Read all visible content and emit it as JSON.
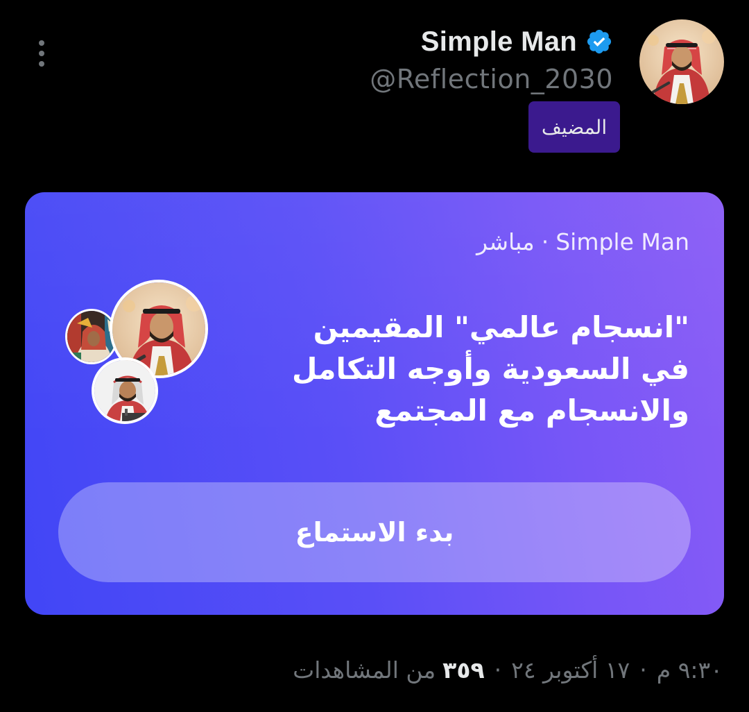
{
  "post": {
    "author": {
      "display_name": "Simple Man",
      "handle": "@Reflection_2030",
      "verified": true,
      "verified_color": "#1d9bf0",
      "role_badge": "المضيف",
      "avatar_icon": "profile-photo"
    },
    "more_icon": "more-vertical-icon"
  },
  "space_card": {
    "host_name": "Simple Man",
    "separator": "·",
    "status": "مباشر",
    "title": "\"انسجام عالمي\" المقيمين في السعودية وأوجه التكامل والانسجام مع المجتمع",
    "start_button_label": "بدء الاستماع",
    "gradient_start": "#4146f6",
    "gradient_end": "#8a5cf6"
  },
  "footer": {
    "time": "٩:٣٠ م",
    "dot1": "·",
    "date": "١٧ أكتوبر ٢٤",
    "dot2": "·",
    "views_count": "٣٥٩",
    "views_label": "من المشاهدات"
  }
}
